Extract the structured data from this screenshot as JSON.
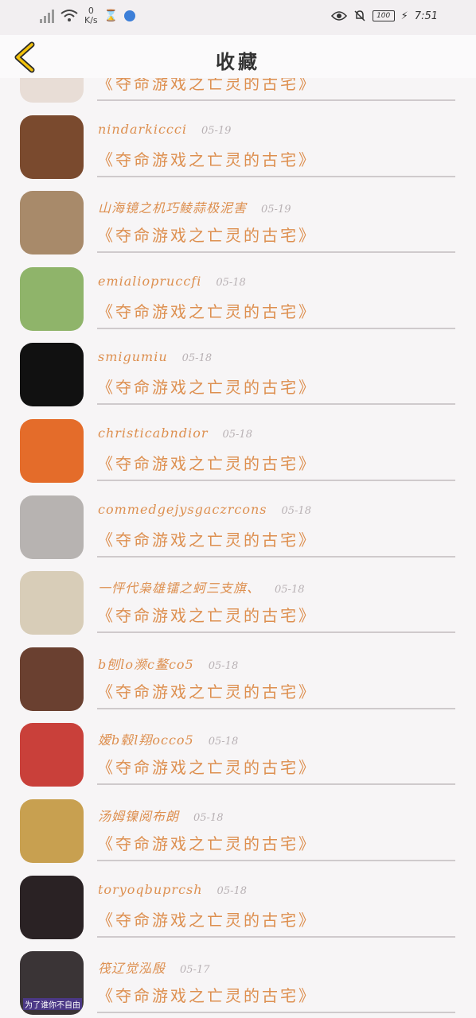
{
  "status": {
    "speed_value": "0",
    "speed_unit": "K/s",
    "battery": "100",
    "time": "7:51"
  },
  "header": {
    "title": "收藏"
  },
  "items": [
    {
      "name": "",
      "date": "",
      "book": "《夺命游戏之亡灵的古宅》",
      "avatar_color": "#e8ddd6"
    },
    {
      "name": "nindarkiccci",
      "date": "05-19",
      "book": "《夺命游戏之亡灵的古宅》",
      "avatar_color": "#7a4a2e"
    },
    {
      "name": "山海镜之机巧鲮蒜极泥害",
      "date": "05-19",
      "book": "《夺命游戏之亡灵的古宅》",
      "avatar_color": "#a88a6a"
    },
    {
      "name": "emialiopruccfi",
      "date": "05-18",
      "book": "《夺命游戏之亡灵的古宅》",
      "avatar_color": "#8fb46a"
    },
    {
      "name": "smigumiu",
      "date": "05-18",
      "book": "《夺命游戏之亡灵的古宅》",
      "avatar_color": "#111111"
    },
    {
      "name": "christicabndior",
      "date": "05-18",
      "book": "《夺命游戏之亡灵的古宅》",
      "avatar_color": "#e46c2a"
    },
    {
      "name": "commedgejysgaczrcons",
      "date": "05-18",
      "book": "《夺命游戏之亡灵的古宅》",
      "avatar_color": "#b7b3b1"
    },
    {
      "name": "一怦代枭雄镭之蚵三支旗、",
      "date": "05-18",
      "book": "《夺命游戏之亡灵的古宅》",
      "avatar_color": "#d8cdb8"
    },
    {
      "name": "b刨lo濒c鳌co5",
      "date": "05-18",
      "book": "《夺命游戏之亡灵的古宅》",
      "avatar_color": "#6a4030"
    },
    {
      "name": "嫒b毂l翔occo5",
      "date": "05-18",
      "book": "《夺命游戏之亡灵的古宅》",
      "avatar_color": "#c9403a"
    },
    {
      "name": "汤姆镍阅布朗",
      "date": "05-18",
      "book": "《夺命游戏之亡灵的古宅》",
      "avatar_color": "#c8a050"
    },
    {
      "name": "toryoqbuprcsh",
      "date": "05-18",
      "book": "《夺命游戏之亡灵的古宅》",
      "avatar_color": "#2a2224"
    },
    {
      "name": "筏辽觉泓殷",
      "date": "05-17",
      "book": "《夺命游戏之亡灵的古宅》",
      "avatar_color": "#3a3436"
    }
  ],
  "last_avatar_caption": "为了谁你不自由"
}
